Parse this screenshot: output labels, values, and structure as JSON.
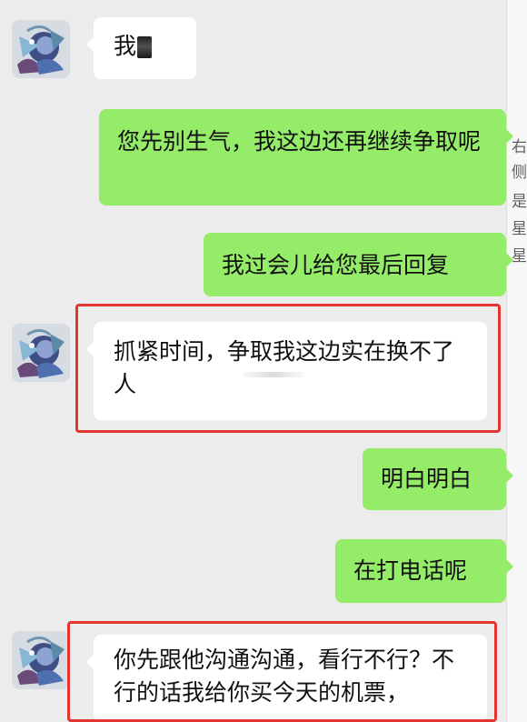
{
  "messages": [
    {
      "side": "left",
      "text": "我",
      "highlighted": false
    },
    {
      "side": "right",
      "text": "您先别生气，我这边还再继续争取呢"
    },
    {
      "side": "right",
      "text": "我过会儿给您最后回复"
    },
    {
      "side": "left",
      "text": "抓紧时间，争取我这边实在换不了人",
      "highlighted": true
    },
    {
      "side": "right",
      "text": "明白明白"
    },
    {
      "side": "right",
      "text": "在打电话呢"
    },
    {
      "side": "left",
      "text": "你先跟他沟通沟通，看行不行？不行的话我给你买今天的机票，",
      "highlighted": true
    }
  ],
  "right_edge_chars": [
    "右",
    "侧",
    "是",
    "星",
    "星"
  ],
  "colors": {
    "incoming_bubble": "#ffffff",
    "outgoing_bubble": "#95ec69",
    "highlight_border": "#e3342f",
    "chat_background": "#ececec"
  },
  "icons": {
    "avatar": "abstract-avatar-icon"
  }
}
